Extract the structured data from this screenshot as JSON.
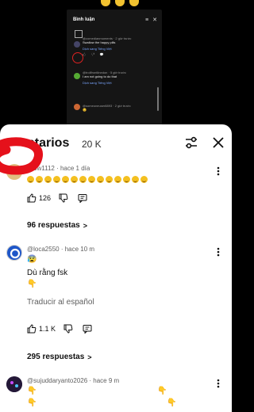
{
  "video": {
    "overlay_title": "Bình luận",
    "mini_comments": [
      {
        "user": "@comedianmoments · 2 giờ trước",
        "text": "Swallow the happy pills",
        "translate": "Dịch sang Tiếng Việt"
      },
      {
        "user": "@trollfrontlinedon · 5 giờ trước",
        "text": "I am not going to do that",
        "translate": "Dịch sang Tiếng Việt"
      },
      {
        "user": "@someoneuser8893 · 2 giờ trước",
        "text": "😊",
        "translate": ""
      }
    ]
  },
  "sheet": {
    "title": "ntarios",
    "count": "20 K"
  },
  "comments": [
    {
      "meta": "allow1112 · hace 1 día",
      "likes": "126",
      "replies": "96 respuestas"
    },
    {
      "meta": "@loca2550 · hace 10 m",
      "emoji": "😰",
      "text": "Dù rằng fsk",
      "hand": "👇",
      "translate": "Traducir al español",
      "likes": "1.1 K",
      "replies": "295 respuestas"
    },
    {
      "meta": "@sujuddaryanto2026 · hace 9 m",
      "hand": "👇",
      "hand_right": "👇"
    }
  ],
  "colors": {
    "sheet_bg": "#ffffff",
    "text": "#0f0f0f",
    "meta": "#606060",
    "annotation": "#e5111b"
  },
  "icons": [
    "filter-icon",
    "close-icon",
    "like-icon",
    "dislike-icon",
    "reply-icon",
    "more-icon"
  ]
}
